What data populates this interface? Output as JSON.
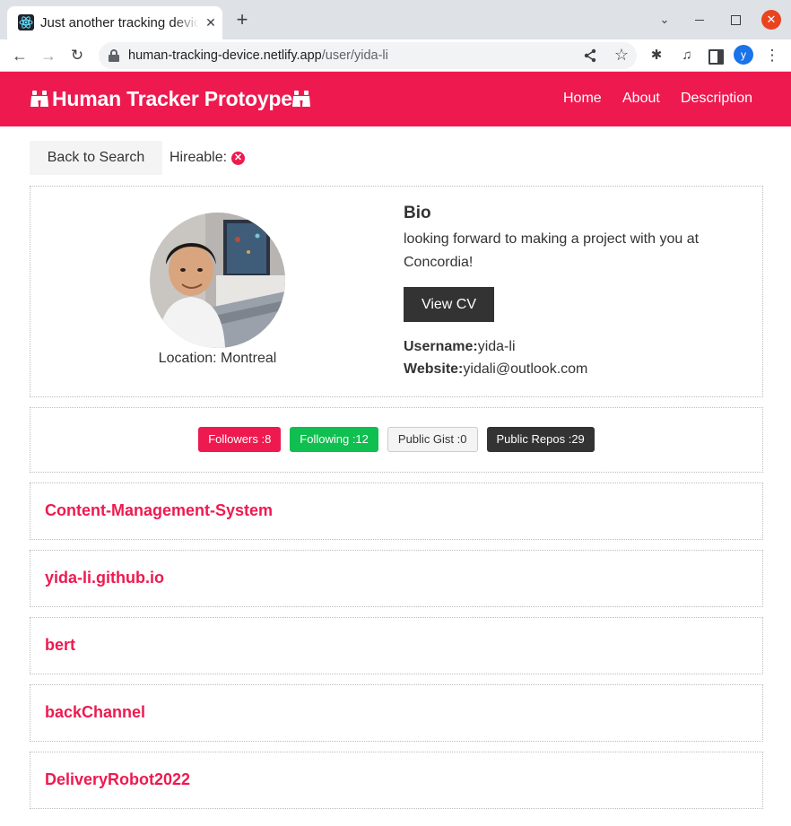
{
  "browser": {
    "tab_title": "Just another tracking device",
    "url_domain": "human-tracking-device.netlify.app",
    "url_path": "/user/yida-li",
    "profile_initial": "y"
  },
  "navbar": {
    "brand": "Human Tracker Protoype",
    "links": [
      "Home",
      "About",
      "Description"
    ],
    "brand_color": "#ee1a4f"
  },
  "actions": {
    "back_label": "Back to Search",
    "hireable_label": "Hireable:",
    "hireable_icon": "times-circle-icon"
  },
  "profile": {
    "location": "Location: Montreal",
    "bio_title": "Bio",
    "bio_text": "looking forward to making a project with you at Concordia!",
    "cv_label": "View CV",
    "username_label": "Username:",
    "username": "yida-li",
    "website_label": "Website:",
    "website": "yidali@outlook.com"
  },
  "stats": {
    "followers": "Followers :8",
    "following": "Following :12",
    "gists": "Public Gist :0",
    "repos": "Public Repos :29"
  },
  "repos": [
    "Content-Management-System",
    "yida-li.github.io",
    "bert",
    "backChannel",
    "DeliveryRobot2022"
  ]
}
